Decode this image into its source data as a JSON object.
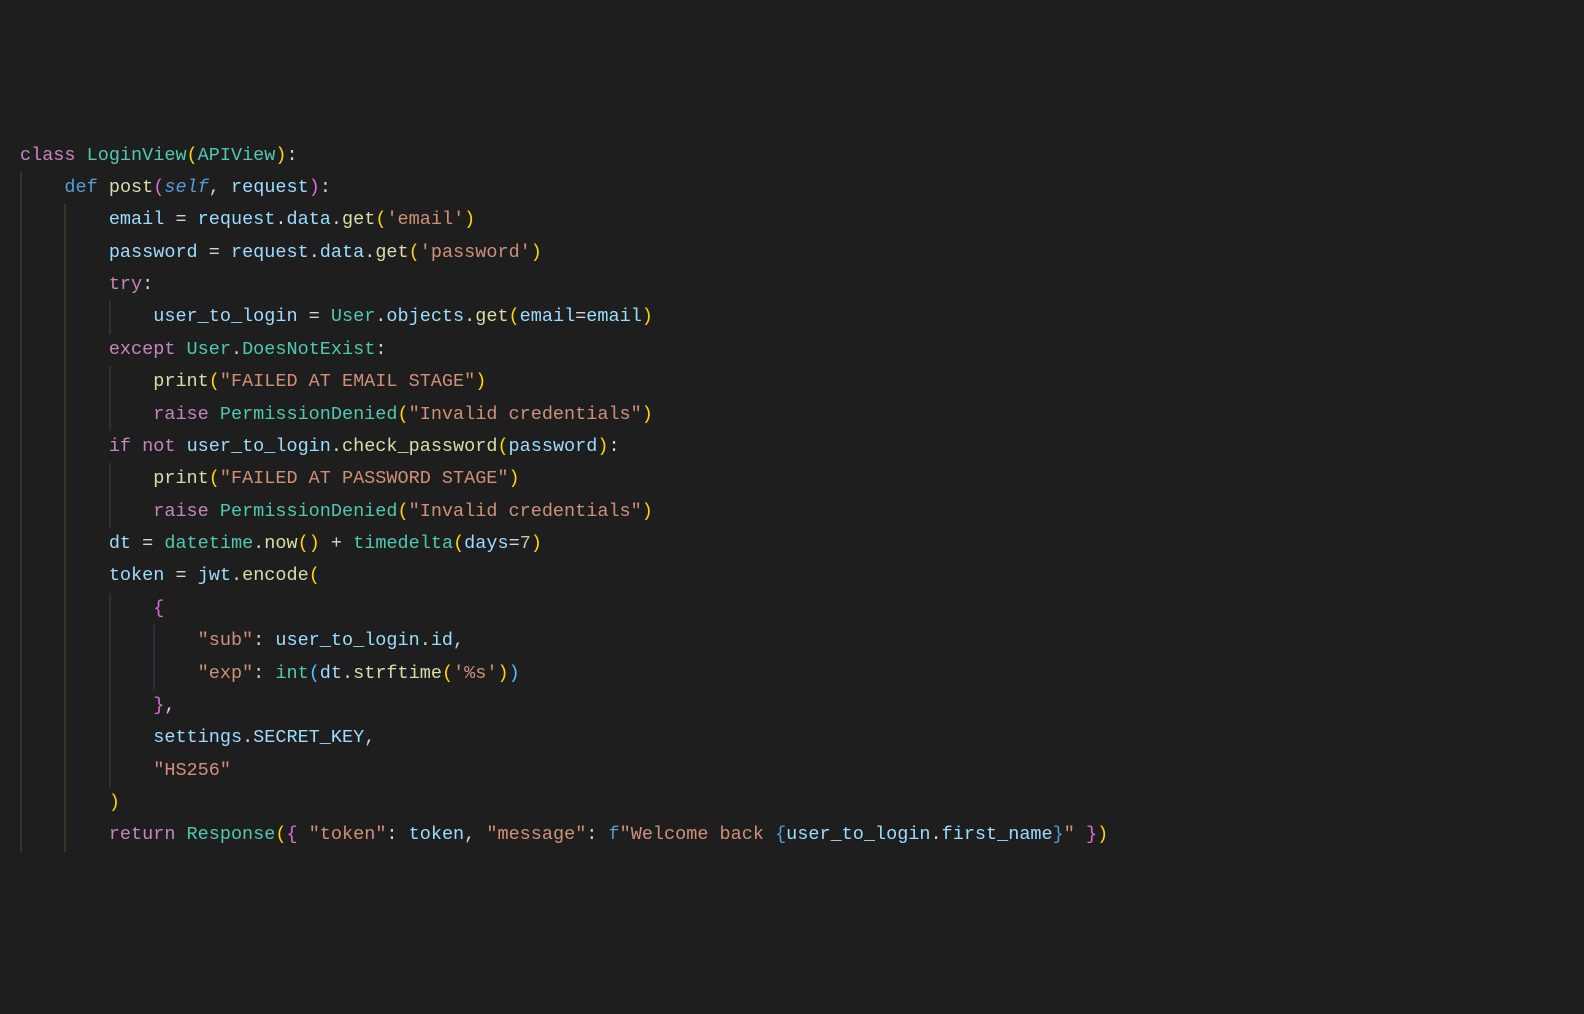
{
  "code": {
    "lines": [
      {
        "indent": 0,
        "tokens": [
          {
            "t": "class ",
            "c": "kw-class"
          },
          {
            "t": "LoginView",
            "c": "classname"
          },
          {
            "t": "(",
            "c": "punct-yellow"
          },
          {
            "t": "APIView",
            "c": "classname"
          },
          {
            "t": ")",
            "c": "punct-yellow"
          },
          {
            "t": ":",
            "c": "punct"
          }
        ]
      },
      {
        "indent": 1,
        "tokens": [
          {
            "t": "def ",
            "c": "kw-def"
          },
          {
            "t": "post",
            "c": "funcdef"
          },
          {
            "t": "(",
            "c": "punct-purple"
          },
          {
            "t": "self",
            "c": "selfkw"
          },
          {
            "t": ", ",
            "c": "punct"
          },
          {
            "t": "request",
            "c": "param"
          },
          {
            "t": ")",
            "c": "punct-purple"
          },
          {
            "t": ":",
            "c": "punct"
          }
        ]
      },
      {
        "indent": 2,
        "tokens": [
          {
            "t": "email ",
            "c": "param"
          },
          {
            "t": "=",
            "c": "op"
          },
          {
            "t": " request",
            "c": "param"
          },
          {
            "t": ".",
            "c": "punct"
          },
          {
            "t": "data",
            "c": "attr"
          },
          {
            "t": ".",
            "c": "punct"
          },
          {
            "t": "get",
            "c": "funcname"
          },
          {
            "t": "(",
            "c": "punct-yellow"
          },
          {
            "t": "'email'",
            "c": "str"
          },
          {
            "t": ")",
            "c": "punct-yellow"
          }
        ]
      },
      {
        "indent": 2,
        "tokens": [
          {
            "t": "password ",
            "c": "param"
          },
          {
            "t": "=",
            "c": "op"
          },
          {
            "t": " request",
            "c": "param"
          },
          {
            "t": ".",
            "c": "punct"
          },
          {
            "t": "data",
            "c": "attr"
          },
          {
            "t": ".",
            "c": "punct"
          },
          {
            "t": "get",
            "c": "funcname"
          },
          {
            "t": "(",
            "c": "punct-yellow"
          },
          {
            "t": "'password'",
            "c": "str"
          },
          {
            "t": ")",
            "c": "punct-yellow"
          }
        ]
      },
      {
        "indent": 2,
        "tokens": [
          {
            "t": "try",
            "c": "kw-class"
          },
          {
            "t": ":",
            "c": "punct"
          }
        ]
      },
      {
        "indent": 3,
        "tokens": [
          {
            "t": "user_to_login ",
            "c": "param"
          },
          {
            "t": "=",
            "c": "op"
          },
          {
            "t": " User",
            "c": "classname"
          },
          {
            "t": ".",
            "c": "punct"
          },
          {
            "t": "objects",
            "c": "attr"
          },
          {
            "t": ".",
            "c": "punct"
          },
          {
            "t": "get",
            "c": "funcname"
          },
          {
            "t": "(",
            "c": "punct-yellow"
          },
          {
            "t": "email",
            "c": "param"
          },
          {
            "t": "=",
            "c": "op"
          },
          {
            "t": "email",
            "c": "param"
          },
          {
            "t": ")",
            "c": "punct-yellow"
          }
        ]
      },
      {
        "indent": 2,
        "tokens": [
          {
            "t": "except ",
            "c": "kw-class"
          },
          {
            "t": "User",
            "c": "classname"
          },
          {
            "t": ".",
            "c": "punct"
          },
          {
            "t": "DoesNotExist",
            "c": "classname"
          },
          {
            "t": ":",
            "c": "punct"
          }
        ]
      },
      {
        "indent": 3,
        "tokens": [
          {
            "t": "print",
            "c": "funcname"
          },
          {
            "t": "(",
            "c": "punct-yellow"
          },
          {
            "t": "\"FAILED AT EMAIL STAGE\"",
            "c": "str"
          },
          {
            "t": ")",
            "c": "punct-yellow"
          }
        ]
      },
      {
        "indent": 3,
        "tokens": [
          {
            "t": "raise ",
            "c": "kw-class"
          },
          {
            "t": "PermissionDenied",
            "c": "classname"
          },
          {
            "t": "(",
            "c": "punct-yellow"
          },
          {
            "t": "\"Invalid credentials\"",
            "c": "str"
          },
          {
            "t": ")",
            "c": "punct-yellow"
          }
        ]
      },
      {
        "indent": 2,
        "tokens": [
          {
            "t": "if ",
            "c": "kw-class"
          },
          {
            "t": "not ",
            "c": "kw-class"
          },
          {
            "t": "user_to_login",
            "c": "param"
          },
          {
            "t": ".",
            "c": "punct"
          },
          {
            "t": "check_password",
            "c": "funcname"
          },
          {
            "t": "(",
            "c": "punct-yellow"
          },
          {
            "t": "password",
            "c": "param"
          },
          {
            "t": ")",
            "c": "punct-yellow"
          },
          {
            "t": ":",
            "c": "punct"
          }
        ]
      },
      {
        "indent": 3,
        "tokens": [
          {
            "t": "print",
            "c": "funcname"
          },
          {
            "t": "(",
            "c": "punct-yellow"
          },
          {
            "t": "\"FAILED AT PASSWORD STAGE\"",
            "c": "str"
          },
          {
            "t": ")",
            "c": "punct-yellow"
          }
        ]
      },
      {
        "indent": 3,
        "tokens": [
          {
            "t": "raise ",
            "c": "kw-class"
          },
          {
            "t": "PermissionDenied",
            "c": "classname"
          },
          {
            "t": "(",
            "c": "punct-yellow"
          },
          {
            "t": "\"Invalid credentials\"",
            "c": "str"
          },
          {
            "t": ")",
            "c": "punct-yellow"
          }
        ]
      },
      {
        "indent": 2,
        "tokens": [
          {
            "t": "dt ",
            "c": "param"
          },
          {
            "t": "=",
            "c": "op"
          },
          {
            "t": " datetime",
            "c": "classname"
          },
          {
            "t": ".",
            "c": "punct"
          },
          {
            "t": "now",
            "c": "funcname"
          },
          {
            "t": "(",
            "c": "punct-yellow"
          },
          {
            "t": ")",
            "c": "punct-yellow"
          },
          {
            "t": " ",
            "c": "op"
          },
          {
            "t": "+",
            "c": "op"
          },
          {
            "t": " ",
            "c": "op"
          },
          {
            "t": "timedelta",
            "c": "classname"
          },
          {
            "t": "(",
            "c": "punct-yellow"
          },
          {
            "t": "days",
            "c": "param"
          },
          {
            "t": "=",
            "c": "op"
          },
          {
            "t": "7",
            "c": "num"
          },
          {
            "t": ")",
            "c": "punct-yellow"
          }
        ]
      },
      {
        "indent": 2,
        "tokens": [
          {
            "t": "token ",
            "c": "param"
          },
          {
            "t": "=",
            "c": "op"
          },
          {
            "t": " jwt",
            "c": "param"
          },
          {
            "t": ".",
            "c": "punct"
          },
          {
            "t": "encode",
            "c": "funcname"
          },
          {
            "t": "(",
            "c": "punct-yellow"
          }
        ]
      },
      {
        "indent": 3,
        "tokens": [
          {
            "t": "{",
            "c": "punct-purple"
          }
        ]
      },
      {
        "indent": 4,
        "tokens": [
          {
            "t": "\"sub\"",
            "c": "str"
          },
          {
            "t": ": ",
            "c": "punct"
          },
          {
            "t": "user_to_login",
            "c": "param"
          },
          {
            "t": ".",
            "c": "punct"
          },
          {
            "t": "id",
            "c": "attr"
          },
          {
            "t": ",",
            "c": "punct"
          }
        ]
      },
      {
        "indent": 4,
        "tokens": [
          {
            "t": "\"exp\"",
            "c": "str"
          },
          {
            "t": ": ",
            "c": "punct"
          },
          {
            "t": "int",
            "c": "builtin"
          },
          {
            "t": "(",
            "c": "punct-blue"
          },
          {
            "t": "dt",
            "c": "param"
          },
          {
            "t": ".",
            "c": "punct"
          },
          {
            "t": "strftime",
            "c": "funcname"
          },
          {
            "t": "(",
            "c": "punct-yellow"
          },
          {
            "t": "'%s'",
            "c": "str"
          },
          {
            "t": ")",
            "c": "punct-yellow"
          },
          {
            "t": ")",
            "c": "punct-blue"
          }
        ]
      },
      {
        "indent": 3,
        "tokens": [
          {
            "t": "}",
            "c": "punct-purple"
          },
          {
            "t": ",",
            "c": "punct"
          }
        ]
      },
      {
        "indent": 3,
        "tokens": [
          {
            "t": "settings",
            "c": "param"
          },
          {
            "t": ".",
            "c": "punct"
          },
          {
            "t": "SECRET_KEY",
            "c": "attr"
          },
          {
            "t": ",",
            "c": "punct"
          }
        ]
      },
      {
        "indent": 3,
        "tokens": [
          {
            "t": "\"HS256\"",
            "c": "str"
          }
        ]
      },
      {
        "indent": 2,
        "tokens": [
          {
            "t": ")",
            "c": "punct-yellow"
          }
        ]
      },
      {
        "indent": 2,
        "tokens": [
          {
            "t": "return ",
            "c": "kw-class"
          },
          {
            "t": "Response",
            "c": "classname"
          },
          {
            "t": "(",
            "c": "punct-yellow"
          },
          {
            "t": "{ ",
            "c": "punct-purple"
          },
          {
            "t": "\"token\"",
            "c": "str"
          },
          {
            "t": ": ",
            "c": "punct"
          },
          {
            "t": "token",
            "c": "param"
          },
          {
            "t": ", ",
            "c": "punct"
          },
          {
            "t": "\"message\"",
            "c": "str"
          },
          {
            "t": ": ",
            "c": "punct"
          },
          {
            "t": "f",
            "c": "kw-def"
          },
          {
            "t": "\"Welcome back ",
            "c": "str"
          },
          {
            "t": "{",
            "c": "fstring-brace"
          },
          {
            "t": "user_to_login",
            "c": "param"
          },
          {
            "t": ".",
            "c": "punct"
          },
          {
            "t": "first_name",
            "c": "attr"
          },
          {
            "t": "}",
            "c": "fstring-brace"
          },
          {
            "t": "\"",
            "c": "str"
          },
          {
            "t": " }",
            "c": "punct-purple"
          },
          {
            "t": ")",
            "c": "punct-yellow"
          }
        ]
      }
    ],
    "indent_unit": "    ",
    "guide_colors": [
      "#403030",
      "#3a3a28",
      "#283828",
      "#283040",
      "#382840"
    ]
  }
}
